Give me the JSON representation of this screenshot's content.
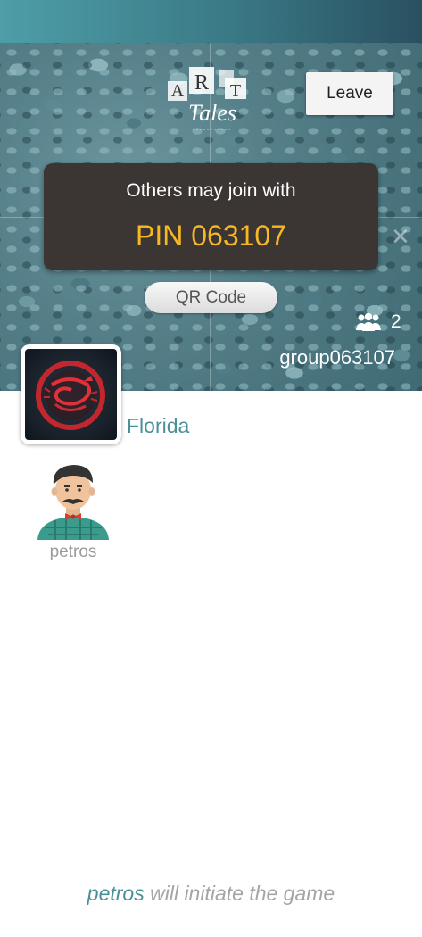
{
  "header": {
    "accent_color": "#3a7986"
  },
  "logo": {
    "letters": [
      "A",
      "R",
      "T"
    ],
    "word": "Tales"
  },
  "leave_button": {
    "label": "Leave"
  },
  "pin_box": {
    "caption": "Others may join with",
    "pin": "PIN 063107",
    "pin_color": "#f7b824"
  },
  "qr_button": {
    "label": "QR Code"
  },
  "group": {
    "member_count": "2",
    "name": "group063107",
    "icon": "users-icon"
  },
  "team": {
    "name": "Florida",
    "avatar_icon": "scorpion-emblem-icon"
  },
  "players": [
    {
      "name": "petros",
      "avatar_icon": "mustache-man-avatar-icon"
    }
  ],
  "footer": {
    "initiator": "petros",
    "message": "will initiate the game"
  }
}
